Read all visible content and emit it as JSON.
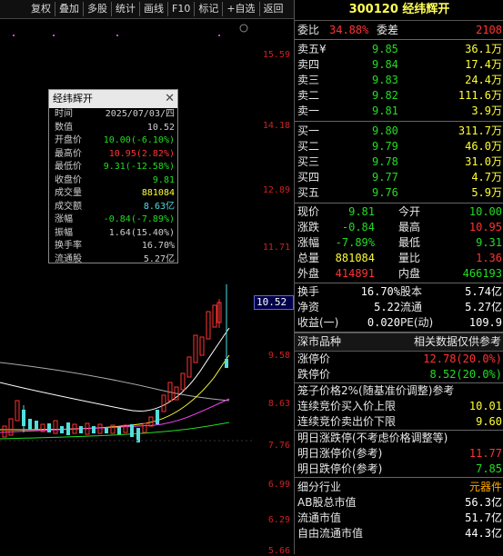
{
  "toolbar": {
    "buttons": [
      "复权",
      "叠加",
      "多股",
      "统计",
      "画线",
      "F10",
      "标记",
      "+自选",
      "返回"
    ]
  },
  "yaxis": {
    "labels": [
      "15.59",
      "14.18",
      "12.89",
      "11.71",
      "9.58",
      "8.63",
      "7.76",
      "6.99",
      "6.29",
      "5.66"
    ],
    "current": "10.52"
  },
  "popup": {
    "title": "经纬辉开",
    "rows": [
      {
        "k": "时间",
        "v": "2025/07/03/四",
        "c": "#d0d0d0"
      },
      {
        "k": "数值",
        "v": "10.52",
        "c": "#d0d0d0"
      },
      {
        "k": "开盘价",
        "v": "10.00(-6.10%)",
        "c": "#22dd22"
      },
      {
        "k": "最高价",
        "v": "10.95(2.82%)",
        "c": "#ff3333"
      },
      {
        "k": "最低价",
        "v": "9.31(-12.58%)",
        "c": "#22dd22"
      },
      {
        "k": "收盘价",
        "v": "9.81",
        "c": "#22dd22"
      },
      {
        "k": "成交量",
        "v": "881084",
        "c": "#ffff33"
      },
      {
        "k": "成交额",
        "v": "8.63亿",
        "c": "#55dddd"
      },
      {
        "k": "涨幅",
        "v": "-0.84(-7.89%)",
        "c": "#22dd22"
      },
      {
        "k": "振幅",
        "v": "1.64(15.40%)",
        "c": "#d0d0d0"
      },
      {
        "k": "换手率",
        "v": "16.70%",
        "c": "#d0d0d0"
      },
      {
        "k": "流通股",
        "v": "5.27亿",
        "c": "#d0d0d0"
      }
    ]
  },
  "panel": {
    "title": "300120 经纬辉开",
    "weibi": {
      "label": "委比",
      "value": "34.88%",
      "label2": "委差",
      "value2": "2108"
    },
    "sells": [
      {
        "label": "卖五¥",
        "price": "9.85",
        "vol": "36.1万"
      },
      {
        "label": "卖四",
        "price": "9.84",
        "vol": "17.4万"
      },
      {
        "label": "卖三",
        "price": "9.83",
        "vol": "24.4万"
      },
      {
        "label": "卖二",
        "price": "9.82",
        "vol": "111.6万"
      },
      {
        "label": "卖一",
        "price": "9.81",
        "vol": "3.9万"
      }
    ],
    "buys": [
      {
        "label": "买一",
        "price": "9.80",
        "vol": "311.7万"
      },
      {
        "label": "买二",
        "price": "9.79",
        "vol": "46.0万"
      },
      {
        "label": "买三",
        "price": "9.78",
        "vol": "31.0万"
      },
      {
        "label": "买四",
        "price": "9.77",
        "vol": "4.7万"
      },
      {
        "label": "买五",
        "price": "9.76",
        "vol": "5.9万"
      }
    ],
    "quote": [
      {
        "l1": "现价",
        "v1": "9.81",
        "c1": "green",
        "l2": "今开",
        "v2": "10.00",
        "c2": "green"
      },
      {
        "l1": "涨跌",
        "v1": "-0.84",
        "c1": "green",
        "l2": "最高",
        "v2": "10.95",
        "c2": "red"
      },
      {
        "l1": "涨幅",
        "v1": "-7.89%",
        "c1": "green",
        "l2": "最低",
        "v2": "9.31",
        "c2": "green"
      },
      {
        "l1": "总量",
        "v1": "881084",
        "c1": "yellow",
        "l2": "量比",
        "v2": "1.36",
        "c2": "red"
      },
      {
        "l1": "外盘",
        "v1": "414891",
        "c1": "red",
        "l2": "内盘",
        "v2": "466193",
        "c2": "green"
      }
    ],
    "stats": [
      {
        "l1": "换手",
        "v1": "16.70%",
        "l2": "股本",
        "v2": "5.74亿"
      },
      {
        "l1": "净资",
        "v1": "5.22",
        "l2": "流通",
        "v2": "5.27亿"
      },
      {
        "l1": "收益(一)",
        "v1": "0.020",
        "l2": "PE(动)",
        "v2": "109.9"
      }
    ],
    "market": {
      "left": "深市品种",
      "right": "相关数据仅供参考"
    },
    "limits": [
      {
        "label": "涨停价",
        "value": "12.78(20.0%)",
        "c": "red"
      },
      {
        "label": "跌停价",
        "value": "8.52(20.0%)",
        "c": "green"
      }
    ],
    "cage": [
      {
        "label": "笼子价格2%(随基准价调整)参考",
        "value": "",
        "c": "white"
      },
      {
        "label": "连续竞价买入价上限",
        "value": "10.01",
        "c": "yellow"
      },
      {
        "label": "连续竞价卖出价下限",
        "value": "9.60",
        "c": "yellow"
      }
    ],
    "tomorrow": [
      {
        "label": "明日涨跌停(不考虑价格调整等)",
        "value": "",
        "c": "white"
      },
      {
        "label": "明日涨停价(参考)",
        "value": "11.77",
        "c": "red"
      },
      {
        "label": "明日跌停价(参考)",
        "value": "7.85",
        "c": "green"
      }
    ],
    "industry": [
      {
        "label": "细分行业",
        "value": "元器件",
        "c": "orange"
      },
      {
        "label": "AB股总市值",
        "value": "56.3亿",
        "c": "white"
      },
      {
        "label": "流通市值",
        "value": "51.7亿",
        "c": "white"
      },
      {
        "label": "自由流通市值",
        "value": "44.3亿",
        "c": "white"
      }
    ]
  },
  "colors": {
    "up": "#ff3333",
    "down": "#22dd22",
    "accent": "#ffff33"
  }
}
